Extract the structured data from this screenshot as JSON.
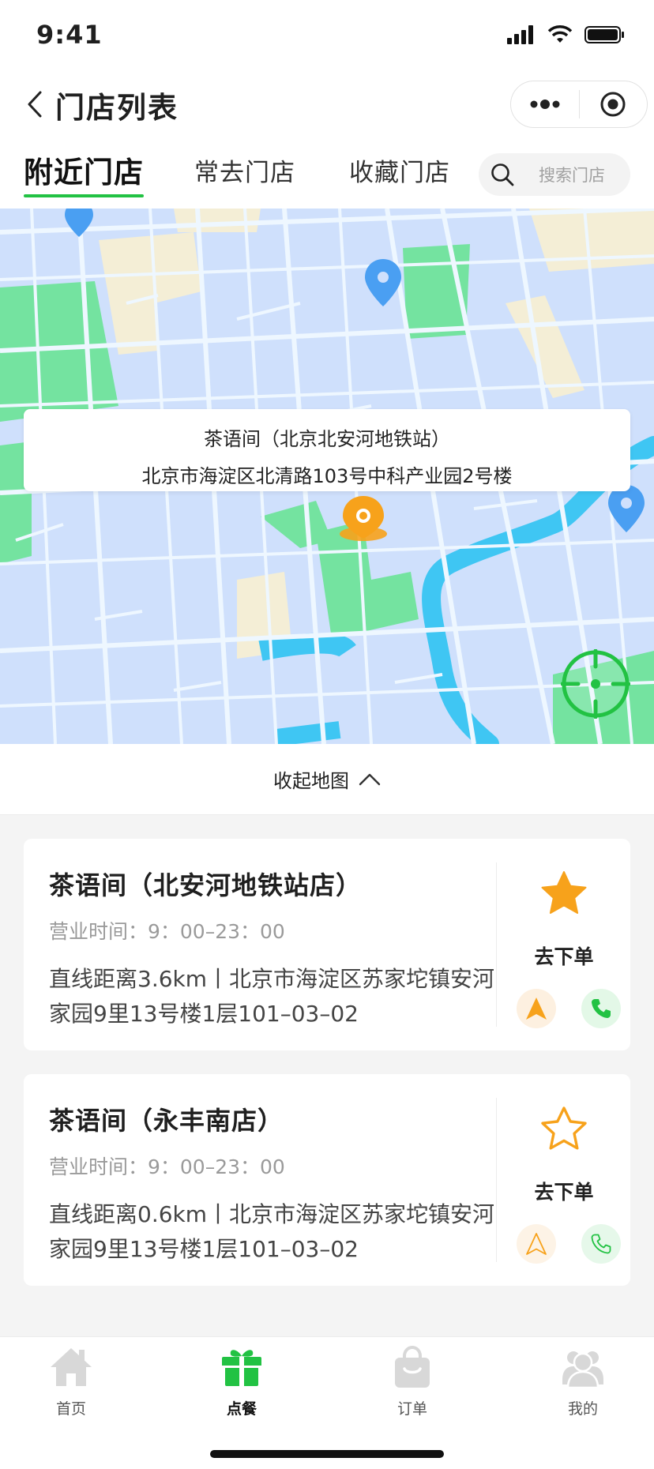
{
  "status": {
    "time": "9:41"
  },
  "nav": {
    "title": "门店列表"
  },
  "tabs": {
    "nearby": "附近门店",
    "frequent": "常去门店",
    "favorites": "收藏门店",
    "search_placeholder": "搜索门店"
  },
  "map": {
    "popup_name": "茶语间（北京北安河地铁站）",
    "popup_address": "北京市海淀区北清路103号中科产业园2号楼"
  },
  "collapse": {
    "label": "收起地图"
  },
  "stores": [
    {
      "name": "茶语间（北安河地铁站店）",
      "hours": "营业时间：9：00–23：00",
      "address": "直线距离3.6km丨北京市海淀区苏家坨镇安河家园9里13号楼1层101–03–02",
      "order_label": "去下单",
      "favorited": true
    },
    {
      "name": "茶语间（永丰南店）",
      "hours": "营业时间：9：00–23：00",
      "address": "直线距离0.6km丨北京市海淀区苏家坨镇安河家园9里13号楼1层101–03–02",
      "order_label": "去下单",
      "favorited": false
    }
  ],
  "tabbar": {
    "home": "首页",
    "order_food": "点餐",
    "orders": "订单",
    "mine": "我的"
  },
  "colors": {
    "accent_green": "#22c243",
    "accent_orange": "#f7a21b",
    "map_water": "#3fc6f3",
    "map_park": "#74e3a0"
  }
}
